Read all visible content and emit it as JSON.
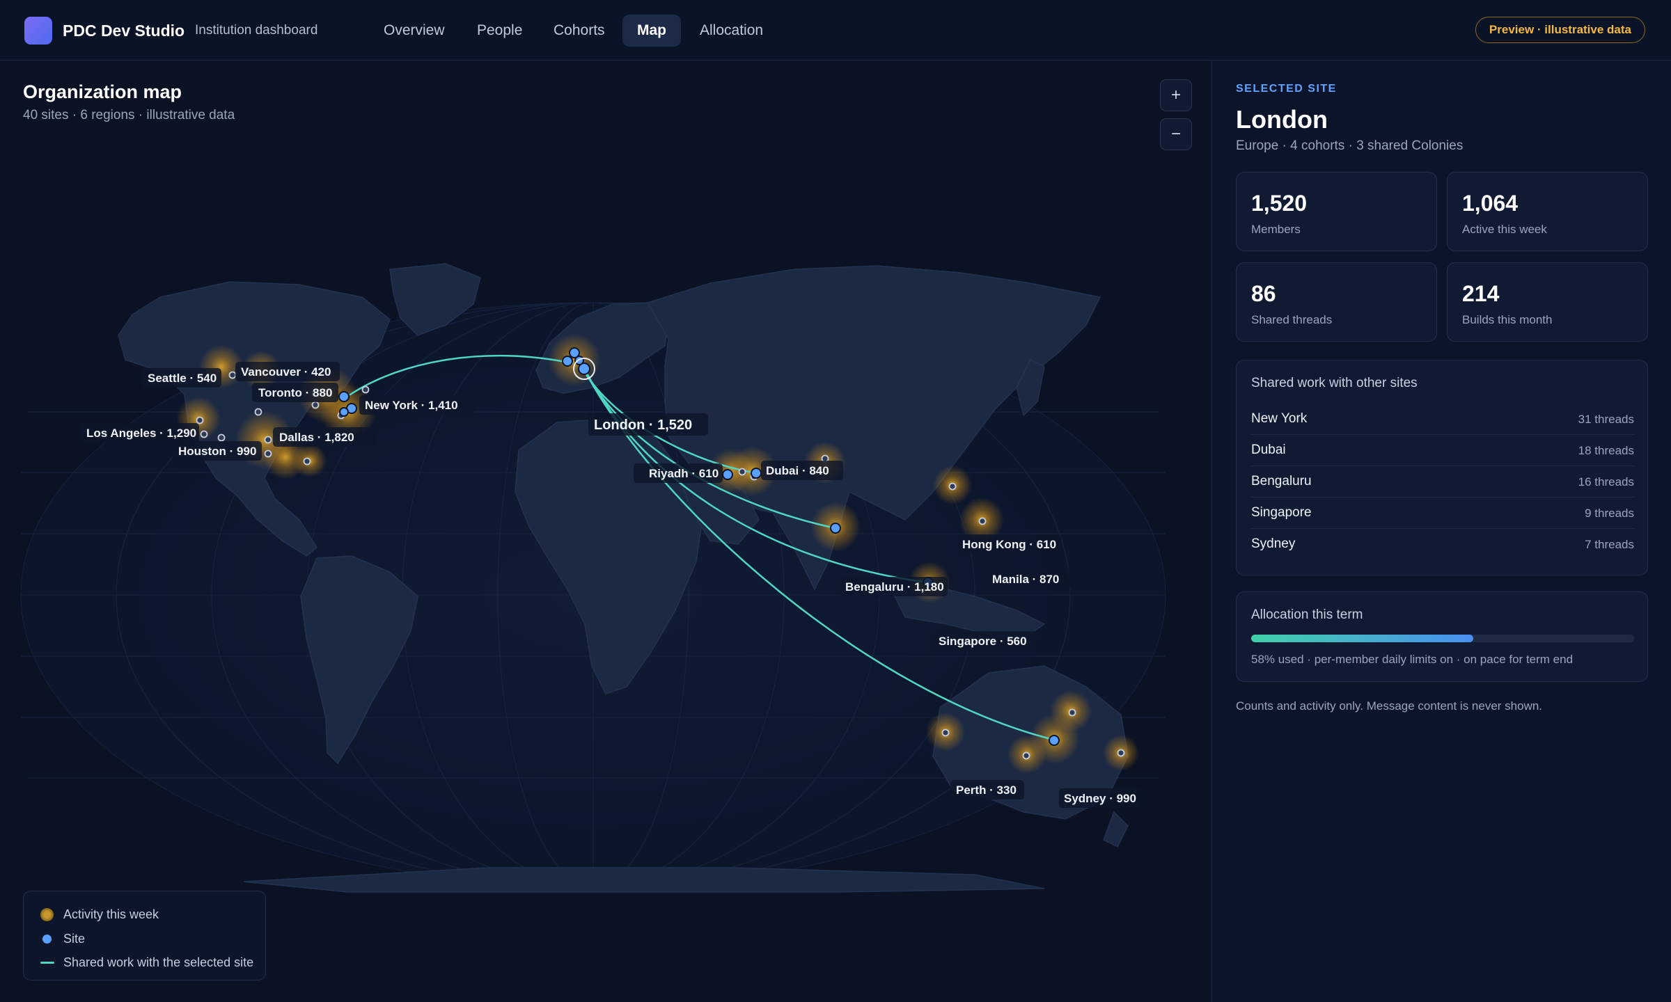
{
  "app": {
    "name": "PDC Dev Studio",
    "context": "Institution dashboard",
    "preview_badge": "Preview · illustrative data"
  },
  "nav": {
    "tabs": [
      {
        "label": "Overview",
        "active": false
      },
      {
        "label": "People",
        "active": false
      },
      {
        "label": "Cohorts",
        "active": false
      },
      {
        "label": "Map",
        "active": true
      },
      {
        "label": "Allocation",
        "active": false
      }
    ]
  },
  "map": {
    "title": "Organization map",
    "subtitle": "40 sites · 6 regions · illustrative data",
    "zoom_in": "+",
    "zoom_out": "−",
    "selected_site": "London",
    "labeled_sites": [
      {
        "name": "Seattle",
        "label": "Seattle · 540"
      },
      {
        "name": "Vancouver",
        "label": "Vancouver · 420"
      },
      {
        "name": "Toronto",
        "label": "Toronto · 880"
      },
      {
        "name": "New York",
        "label": "New York · 1,410"
      },
      {
        "name": "Los Angeles",
        "label": "Los Angeles · 1,290"
      },
      {
        "name": "Dallas",
        "label": "Dallas · 1,820"
      },
      {
        "name": "Houston",
        "label": "Houston · 990"
      },
      {
        "name": "London",
        "label": "London · 1,520"
      },
      {
        "name": "Riyadh",
        "label": "Riyadh · 610"
      },
      {
        "name": "Dubai",
        "label": "Dubai · 840"
      },
      {
        "name": "Hong Kong",
        "label": "Hong Kong · 610"
      },
      {
        "name": "Manila",
        "label": "Manila · 870"
      },
      {
        "name": "Bengaluru",
        "label": "Bengaluru · 1,180"
      },
      {
        "name": "Singapore",
        "label": "Singapore · 560"
      },
      {
        "name": "Perth",
        "label": "Perth · 330"
      },
      {
        "name": "Sydney",
        "label": "Sydney · 990"
      }
    ],
    "shared_links_from_london": [
      "New York",
      "Dubai",
      "Bengaluru",
      "Singapore",
      "Sydney"
    ],
    "colors": {
      "site": "#5aa0ff",
      "activity": "#e8a623",
      "link": "#4fd6c4",
      "land": "#1a2740",
      "ocean": "#0f1a30"
    }
  },
  "legend": {
    "activity": "Activity this week",
    "site": "Site",
    "link": "Shared work with the selected site"
  },
  "side": {
    "eyebrow": "SELECTED SITE",
    "name": "London",
    "meta": "Europe · 4 cohorts · 3 shared Colonies",
    "stats": [
      {
        "value": "1,520",
        "label": "Members"
      },
      {
        "value": "1,064",
        "label": "Active this week"
      },
      {
        "value": "86",
        "label": "Shared threads"
      },
      {
        "value": "214",
        "label": "Builds this month"
      }
    ],
    "shared": {
      "title": "Shared work with other sites",
      "rows": [
        {
          "site": "New York",
          "threads": "31 threads"
        },
        {
          "site": "Dubai",
          "threads": "18 threads"
        },
        {
          "site": "Bengaluru",
          "threads": "16 threads"
        },
        {
          "site": "Singapore",
          "threads": "9 threads"
        },
        {
          "site": "Sydney",
          "threads": "7 threads"
        }
      ]
    },
    "allocation": {
      "title": "Allocation this term",
      "used_percent": 58,
      "text": "58% used · per-member daily limits on · on pace for term end"
    },
    "footnote": "Counts and activity only. Message content is never shown."
  }
}
